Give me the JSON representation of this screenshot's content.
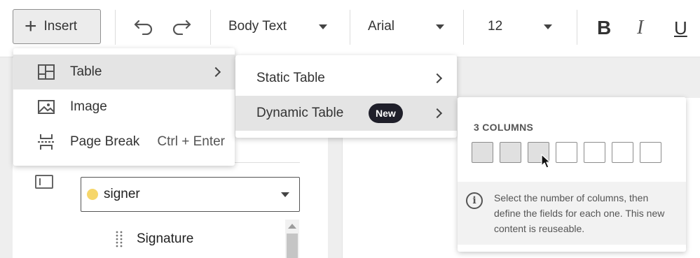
{
  "toolbar": {
    "insert_label": "Insert",
    "style_value": "Body Text",
    "font_value": "Arial",
    "size_value": "12",
    "bold_label": "B",
    "italic_label": "I",
    "underline_label": "U"
  },
  "panel": {
    "signer_value": "signer",
    "field_label": "Signature"
  },
  "insert_menu": {
    "items": [
      {
        "label": "Table",
        "icon": "table-icon"
      },
      {
        "label": "Image",
        "icon": "image-icon"
      },
      {
        "label": "Page Break",
        "icon": "page-break-icon",
        "shortcut": "Ctrl + Enter"
      }
    ]
  },
  "table_submenu": {
    "items": [
      {
        "label": "Static Table"
      },
      {
        "label": "Dynamic Table",
        "badge": "New"
      }
    ]
  },
  "column_picker": {
    "title": "3 COLUMNS",
    "total_columns": 7,
    "selected_columns": 3,
    "info_text": "Select the number of columns, then define the fields for each one. This new content is reuseable."
  },
  "colors": {
    "badge_bg": "#1f1f2a",
    "signer_dot": "#f6d66a",
    "active_item_bg": "#e4e4e4"
  }
}
